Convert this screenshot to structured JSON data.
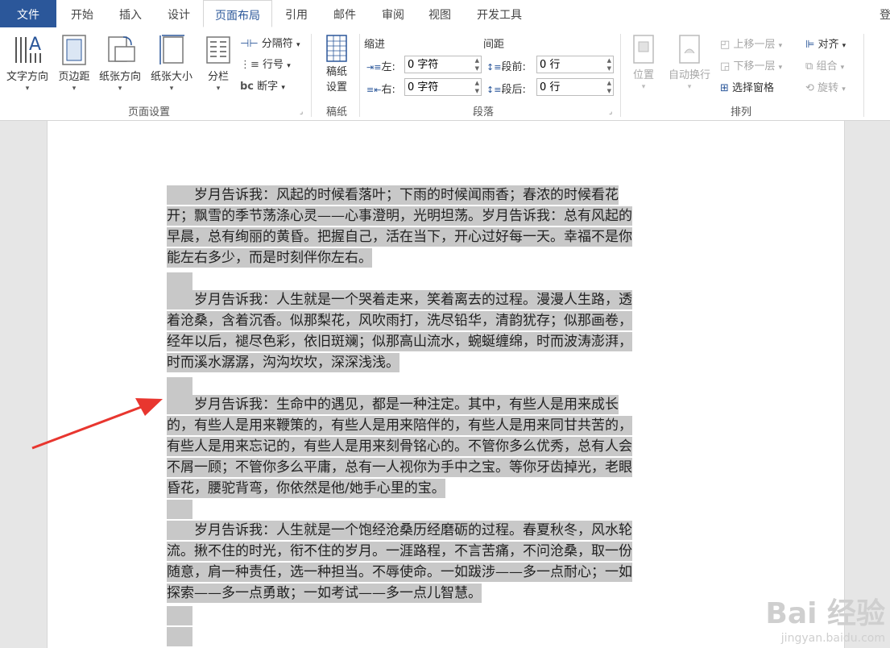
{
  "tabs": [
    {
      "label": "文件",
      "type": "file"
    },
    {
      "label": "开始"
    },
    {
      "label": "插入"
    },
    {
      "label": "设计"
    },
    {
      "label": "页面布局",
      "active": true
    },
    {
      "label": "引用"
    },
    {
      "label": "邮件"
    },
    {
      "label": "审阅"
    },
    {
      "label": "视图"
    },
    {
      "label": "开发工具"
    }
  ],
  "tab_overflow": "登",
  "ribbon": {
    "page_setup": {
      "text_direction": "文字方向",
      "margins": "页边距",
      "orientation": "纸张方向",
      "size": "纸张大小",
      "columns": "分栏",
      "breaks": "分隔符",
      "line_numbers": "行号",
      "hyphenation": "断字",
      "group_label": "页面设置"
    },
    "draft": {
      "draft_settings_1": "稿纸",
      "draft_settings_2": "设置",
      "group_label": "稿纸"
    },
    "paragraph": {
      "indent_title": "缩进",
      "spacing_title": "间距",
      "left_label": "左:",
      "left_value": "0 字符",
      "right_label": "右:",
      "right_value": "0 字符",
      "before_label": "段前:",
      "before_value": "0 行",
      "after_label": "段后:",
      "after_value": "0 行",
      "group_label": "段落"
    },
    "arrange": {
      "position": "位置",
      "wrap_text": "自动换行",
      "bring_forward": "上移一层",
      "send_backward": "下移一层",
      "selection_pane": "选择窗格",
      "align": "对齐",
      "group": "组合",
      "rotate": "旋转",
      "group_label": "排列"
    }
  },
  "document": {
    "paragraphs": [
      [
        "　　岁月告诉我：风起的时候看落叶；下雨的时候闻雨香；春浓的时候看花",
        "开；飘雪的季节荡涤心灵——心事澄明，光明坦荡。岁月告诉我：总有风起的",
        "早晨，总有绚丽的黄昏。把握自己，活在当下，开心过好每一天。幸福不是你",
        "能左右多少，而是时刻伴你左右。"
      ],
      [
        "　　岁月告诉我：人生就是一个哭着走来，笑着离去的过程。漫漫人生路，透",
        "着沧桑，含着沉香。似那梨花，风吹雨打，洗尽铅华，清韵犹存；似那画卷，",
        "经年以后，褪尽色彩，依旧斑斓；似那高山流水，蜿蜒缠绵，时而波涛澎湃，",
        "时而溪水潺潺，沟沟坎坎，深深浅浅。"
      ],
      [
        "　　岁月告诉我：生命中的遇见，都是一种注定。其中，有些人是用来成长",
        "的，有些人是用来鞭策的，有些人是用来陪伴的，有些人是用来同甘共苦的，",
        "有些人是用来忘记的，有些人是用来刻骨铭心的。不管你多么优秀，总有人会",
        "不屑一顾；不管你多么平庸，总有一人视你为手中之宝。等你牙齿掉光，老眼",
        "昏花，腰驼背弯，你依然是他/她手心里的宝。"
      ],
      [
        "　　岁月告诉我：人生就是一个饱经沧桑历经磨砺的过程。春夏秋冬，风水轮",
        "流。揪不住的时光，衔不住的岁月。一涯路程，不言苦痛，不问沧桑，取一份",
        "随意，肩一种责任，选一种担当。不辱使命。一如跋涉——多一点耐心；一如",
        "探索——多一点勇敢；一如考试——多一点儿智慧。"
      ]
    ]
  },
  "watermark": {
    "main": "Bai 经验",
    "url": "jingyan.baidu.com"
  },
  "colors": {
    "file_tab": "#2b579a",
    "selection": "#c8c8c8",
    "arrow": "#e8362f"
  }
}
